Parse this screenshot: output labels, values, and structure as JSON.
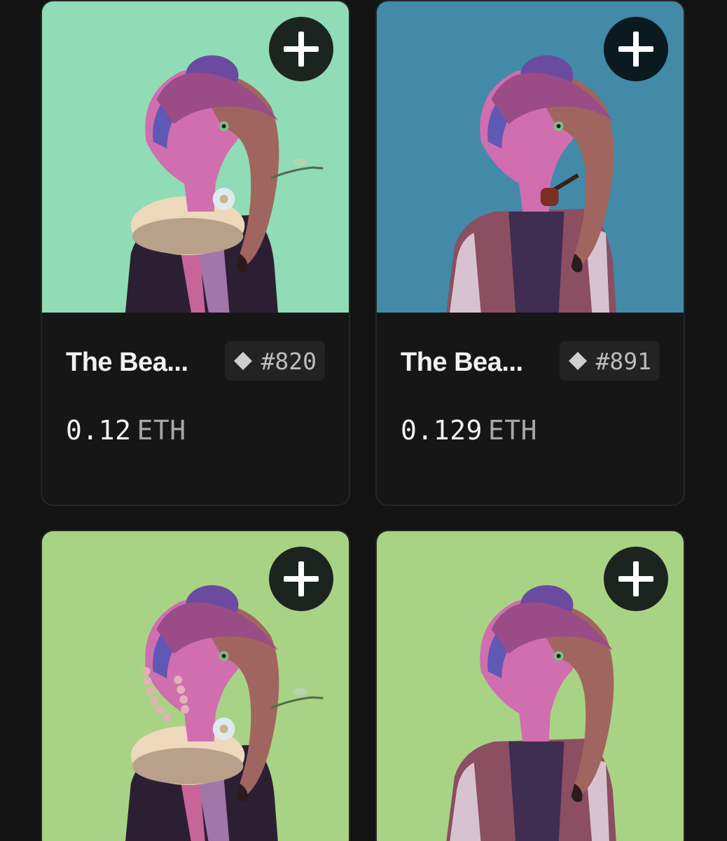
{
  "cards": [
    {
      "name": "The Bea...",
      "token_id": "#820",
      "price_value": "0.12",
      "price_unit": "ETH",
      "bg_color": "#8fdcb6",
      "accessory": "flower-ruff",
      "add_icon": "plus-icon"
    },
    {
      "name": "The Bea...",
      "token_id": "#891",
      "price_value": "0.129",
      "price_unit": "ETH",
      "bg_color": "#428aa8",
      "accessory": "pipe-jacket",
      "add_icon": "plus-icon"
    },
    {
      "name": "",
      "token_id": "",
      "price_value": "",
      "price_unit": "",
      "bg_color": "#a9d384",
      "accessory": "pearls-ruff",
      "add_icon": "plus-icon"
    },
    {
      "name": "",
      "token_id": "",
      "price_value": "",
      "price_unit": "",
      "bg_color": "#a9d384",
      "accessory": "jacket",
      "add_icon": "plus-icon"
    }
  ],
  "colors": {
    "page_bg": "#131313",
    "card_bg": "#161616",
    "text_primary": "#f2f2f2",
    "text_secondary": "#a7a7a7"
  }
}
